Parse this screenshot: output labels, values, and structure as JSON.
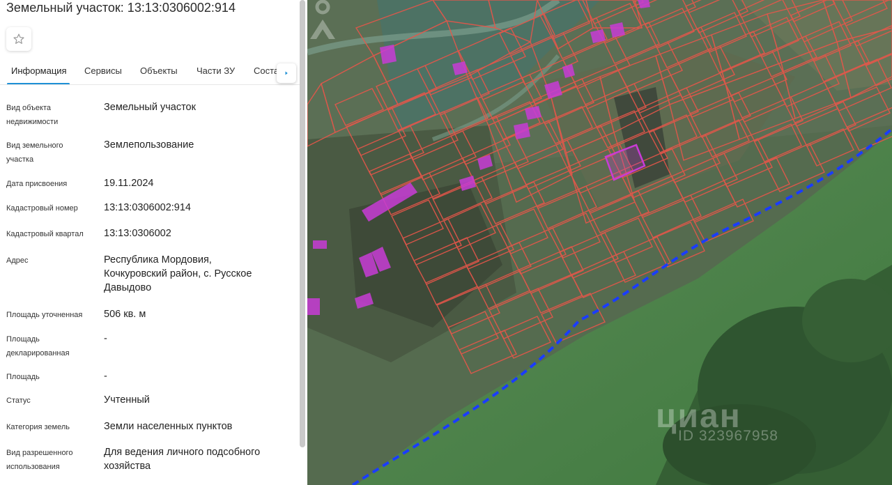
{
  "panel": {
    "title": "Земельный участок: 13:13:0306002:914",
    "tabs": [
      {
        "label": "Информация"
      },
      {
        "label": "Сервисы"
      },
      {
        "label": "Объекты"
      },
      {
        "label": "Части ЗУ"
      },
      {
        "label": "Соста"
      }
    ],
    "rows": [
      {
        "label_lines": [
          "Вид объекта",
          "недвижимости"
        ],
        "value_lines": [
          "Земельный участок"
        ]
      },
      {
        "label_lines": [
          "Вид земельного",
          "участка"
        ],
        "value_lines": [
          "Землепользование"
        ]
      },
      {
        "label_lines": [
          "Дата присвоения"
        ],
        "value_lines": [
          "19.11.2024"
        ]
      },
      {
        "label_lines": [
          "Кадастровый номер"
        ],
        "value_lines": [
          "13:13:0306002:914"
        ]
      },
      {
        "label_lines": [
          "Кадастровый квартал"
        ],
        "value_lines": [
          "13:13:0306002"
        ]
      },
      {
        "label_lines": [
          "Адрес"
        ],
        "value_lines": [
          "Республика Мордовия,",
          "Кочкуровский район, с. Русское",
          "Давыдово"
        ]
      },
      {
        "label_lines": [
          "Площадь уточненная"
        ],
        "value_lines": [
          "506 кв. м"
        ]
      },
      {
        "label_lines": [
          "Площадь",
          "декларированная"
        ],
        "value_lines": [
          "-"
        ]
      },
      {
        "label_lines": [
          "Площадь"
        ],
        "value_lines": [
          "-"
        ]
      },
      {
        "label_lines": [
          "Статус"
        ],
        "value_lines": [
          "Учтенный"
        ]
      },
      {
        "label_lines": [
          "Категория земель"
        ],
        "value_lines": [
          "Земли населенных пунктов"
        ]
      },
      {
        "label_lines": [
          "Вид разрешенного",
          "использования"
        ],
        "value_lines": [
          "Для ведения личного подсобного",
          "хозяйства"
        ]
      }
    ]
  },
  "map": {
    "watermark": "циан",
    "watermark_id": "ID 323967958",
    "colors": {
      "parcel_border": "#e8564a",
      "building": "#c83cd6",
      "boundary": "#1a3cff",
      "accent_tab": "#1e90d6"
    }
  },
  "icons": {
    "favorite": "star-icon",
    "scroll_tabs": "chevron-right-icon",
    "watermark_logo": "cian-logo-icon"
  }
}
